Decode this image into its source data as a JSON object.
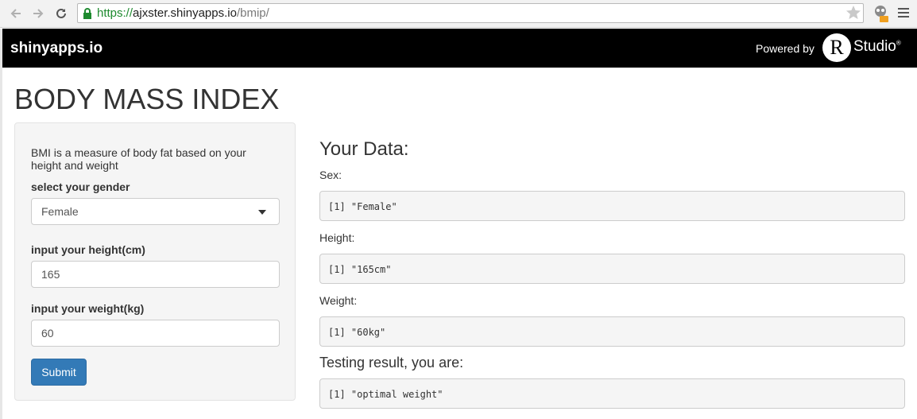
{
  "browser": {
    "url_scheme": "https://",
    "url_host": "ajxster.shinyapps.io",
    "url_path": "/bmip/"
  },
  "appbar": {
    "brand": "shinyapps.io",
    "powered_by": "Powered by",
    "rstudio_r": "R",
    "rstudio_text": "Studio",
    "rstudio_mark": "®"
  },
  "page": {
    "title": "BODY MASS INDEX"
  },
  "sidebar": {
    "description": "BMI is a measure of body fat based on your height and weight",
    "gender_label": "select your gender",
    "gender_value": "Female",
    "height_label": "input your height(cm)",
    "height_value": "165",
    "weight_label": "input your weight(kg)",
    "weight_value": "60",
    "submit_label": "Submit"
  },
  "main": {
    "heading": "Your Data:",
    "sex_label": "Sex:",
    "sex_output": "[1] \"Female\"",
    "height_label": "Height:",
    "height_output": "[1] \"165cm\"",
    "weight_label": "Weight:",
    "weight_output": "[1] \"60kg\"",
    "result_heading": "Testing result, you are:",
    "result_output": "[1] \"optimal weight\""
  },
  "colors": {
    "appbar_bg": "#000000",
    "submit_bg": "#337ab7",
    "sidebar_bg": "#f5f5f5",
    "url_scheme": "#1e8a2f"
  }
}
